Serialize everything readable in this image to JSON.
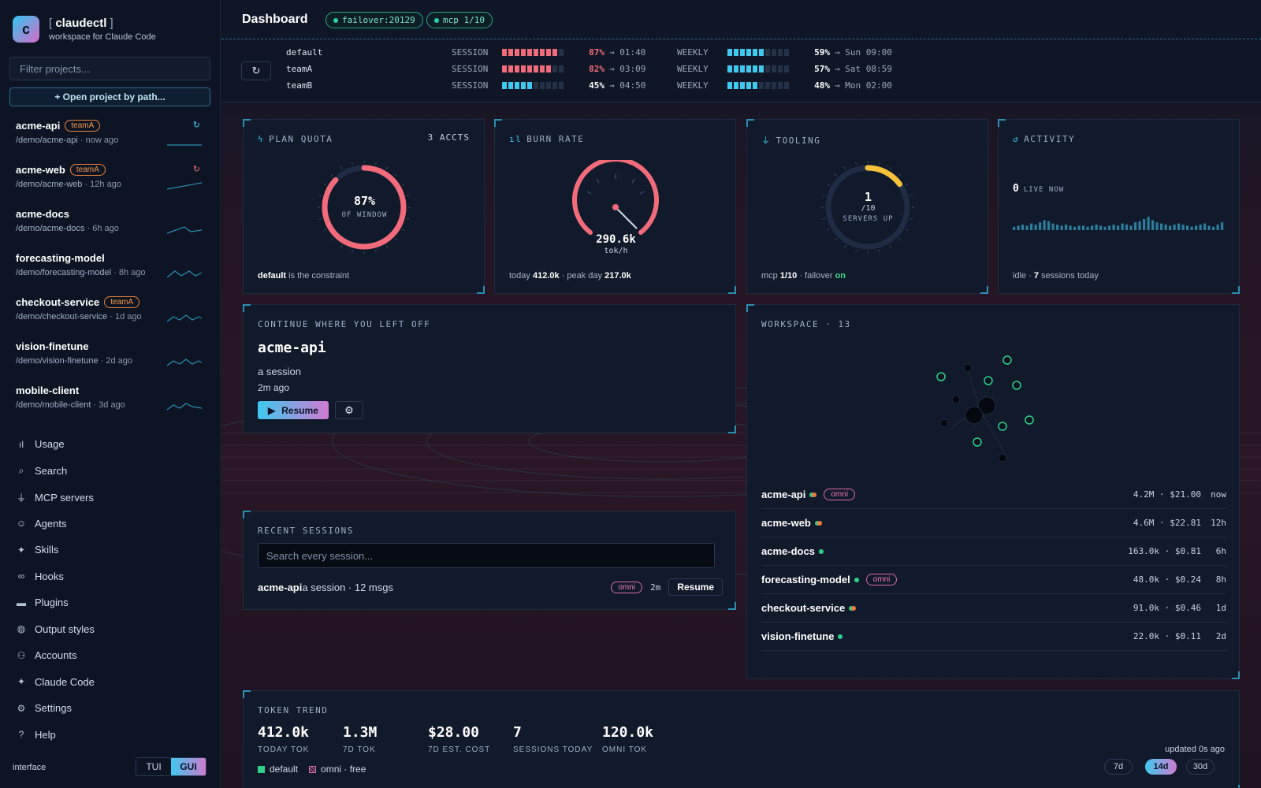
{
  "brand": {
    "logo_letter": "c",
    "bracket_open": "[",
    "name": "claudectl",
    "bracket_close": "]",
    "subtitle": "workspace for Claude Code"
  },
  "filter_placeholder": "Filter projects...",
  "open_project_label": "+ Open project by path...",
  "projects": [
    {
      "name": "acme-api",
      "team": "teamA",
      "path": "/demo/acme-api",
      "ago": "now ago"
    },
    {
      "name": "acme-web",
      "team": "teamA",
      "path": "/demo/acme-web",
      "ago": "12h ago"
    },
    {
      "name": "acme-docs",
      "team": "",
      "path": "/demo/acme-docs",
      "ago": "6h ago"
    },
    {
      "name": "forecasting-model",
      "team": "",
      "path": "/demo/forecasting-model",
      "ago": "8h ago"
    },
    {
      "name": "checkout-service",
      "team": "teamA",
      "path": "/demo/checkout-service",
      "ago": "1d ago"
    },
    {
      "name": "vision-finetune",
      "team": "",
      "path": "/demo/vision-finetune",
      "ago": "2d ago"
    },
    {
      "name": "mobile-client",
      "team": "",
      "path": "/demo/mobile-client",
      "ago": "3d ago"
    }
  ],
  "meta_sep": " · ",
  "nav": [
    {
      "label": "Usage",
      "icon": "bar-chart-icon"
    },
    {
      "label": "Search",
      "icon": "search-icon"
    },
    {
      "label": "MCP servers",
      "icon": "plug-icon"
    },
    {
      "label": "Agents",
      "icon": "robot-icon"
    },
    {
      "label": "Skills",
      "icon": "sparkle-icon"
    },
    {
      "label": "Hooks",
      "icon": "link-icon"
    },
    {
      "label": "Plugins",
      "icon": "folder-icon"
    },
    {
      "label": "Output styles",
      "icon": "palette-icon"
    },
    {
      "label": "Accounts",
      "icon": "users-icon"
    },
    {
      "label": "Claude Code",
      "icon": "sparkle-icon"
    },
    {
      "label": "Settings",
      "icon": "gear-icon"
    },
    {
      "label": "Help",
      "icon": "help-icon"
    }
  ],
  "interface": {
    "label": "interface",
    "tui": "TUI",
    "gui": "GUI",
    "selected": "GUI"
  },
  "header": {
    "title": "Dashboard",
    "pills": [
      "failover:20129",
      "mcp 1/10"
    ]
  },
  "quota_rows": [
    {
      "account": "default",
      "session_label": "SESSION",
      "session_pct": 87,
      "session_pct_text": "87%",
      "session_reset": "→ 01:40",
      "weekly_label": "WEEKLY",
      "weekly_pct": 59,
      "weekly_pct_text": "59%",
      "weekly_reset": "→ Sun 09:00"
    },
    {
      "account": "teamA",
      "session_label": "SESSION",
      "session_pct": 82,
      "session_pct_text": "82%",
      "session_reset": "→ 03:09",
      "weekly_label": "WEEKLY",
      "weekly_pct": 57,
      "weekly_pct_text": "57%",
      "weekly_reset": "→ Sat 08:59"
    },
    {
      "account": "teamB",
      "session_label": "SESSION",
      "session_pct": 45,
      "session_pct_text": "45%",
      "session_reset": "→ 04:50",
      "weekly_label": "WEEKLY",
      "weekly_pct": 48,
      "weekly_pct_text": "48%",
      "weekly_reset": "→ Mon 02:00"
    }
  ],
  "plan_quota": {
    "title": "PLAN QUOTA",
    "accts": "3 ACCTS",
    "value": "87%",
    "fraction": 0.87,
    "sub": "OF WINDOW",
    "foot_bold": "default",
    "foot_rest": " is the constraint"
  },
  "burn_rate": {
    "title": "BURN RATE",
    "value": "290.6k",
    "unit": "tok/h",
    "today_label": "today ",
    "today": "412.0k",
    "peak_label": " · peak day ",
    "peak": "217.0k"
  },
  "tooling": {
    "title": "TOOLING",
    "value": "1",
    "of": "/10",
    "sub": "SERVERS UP",
    "fraction": 0.1,
    "foot_pre": "mcp ",
    "foot_mcp": "1/10",
    "foot_mid": " · failover ",
    "foot_on": "on"
  },
  "activity": {
    "title": "ACTIVITY",
    "live": "0",
    "live_label": "LIVE NOW",
    "foot_pre": "idle · ",
    "foot_sessions": "7",
    "foot_post": " sessions today",
    "bars": [
      3,
      4,
      5,
      4,
      6,
      5,
      7,
      9,
      8,
      6,
      5,
      4,
      5,
      4,
      3,
      4,
      4,
      3,
      4,
      5,
      4,
      3,
      4,
      5,
      4,
      6,
      5,
      4,
      7,
      8,
      10,
      12,
      9,
      7,
      6,
      5,
      4,
      5,
      6,
      5,
      4,
      3,
      4,
      5,
      6,
      4,
      3,
      5,
      7
    ]
  },
  "continue": {
    "title": "CONTINUE WHERE YOU LEFT OFF",
    "project": "acme-api",
    "session": "a session",
    "ago": "2m ago",
    "resume": "Resume"
  },
  "recent": {
    "title": "RECENT SESSIONS",
    "placeholder": "Search every session...",
    "item": {
      "project": "acme-api",
      "rest": " a session · 12 msgs",
      "tag": "omni",
      "ago": "2m",
      "resume": "Resume"
    }
  },
  "workspace": {
    "title": "WORKSPACE · 13",
    "rows": [
      {
        "name": "acme-api",
        "dots": [
          "green",
          "orange"
        ],
        "tag": "omni",
        "tokens": "4.2M · $21.00",
        "ago": "now"
      },
      {
        "name": "acme-web",
        "dots": [
          "green",
          "orange"
        ],
        "tag": "",
        "tokens": "4.6M · $22.81",
        "ago": "12h"
      },
      {
        "name": "acme-docs",
        "dots": [
          "green"
        ],
        "tag": "",
        "tokens": "163.0k · $0.81",
        "ago": "6h"
      },
      {
        "name": "forecasting-model",
        "dots": [
          "green"
        ],
        "tag": "omni",
        "tokens": "48.0k · $0.24",
        "ago": "8h"
      },
      {
        "name": "checkout-service",
        "dots": [
          "green",
          "orange"
        ],
        "tag": "",
        "tokens": "91.0k · $0.46",
        "ago": "1d"
      },
      {
        "name": "vision-finetune",
        "dots": [
          "green"
        ],
        "tag": "",
        "tokens": "22.0k · $0.11",
        "ago": "2d"
      }
    ]
  },
  "token_trend": {
    "title": "TOKEN TREND",
    "stats": [
      {
        "value": "412.0k",
        "label": "TODAY TOK"
      },
      {
        "value": "1.3M",
        "label": "7D TOK"
      },
      {
        "value": "$28.00",
        "label": "7D EST. COST"
      },
      {
        "value": "7",
        "label": "SESSIONS TODAY"
      },
      {
        "value": "120.0k",
        "label": "OMNI TOK"
      }
    ],
    "updated": "updated 0s ago",
    "legend_default": "default",
    "legend_omni": "omni · free",
    "ranges": [
      "7d",
      "14d",
      "30d"
    ],
    "selected_range": "14d"
  },
  "colors": {
    "accent_cyan": "#3ec9f0",
    "accent_pink": "#d07ad0",
    "danger": "#f26b7a",
    "warn": "#f5c23a",
    "ok": "#2fd08c",
    "orange": "#f07a3a"
  }
}
